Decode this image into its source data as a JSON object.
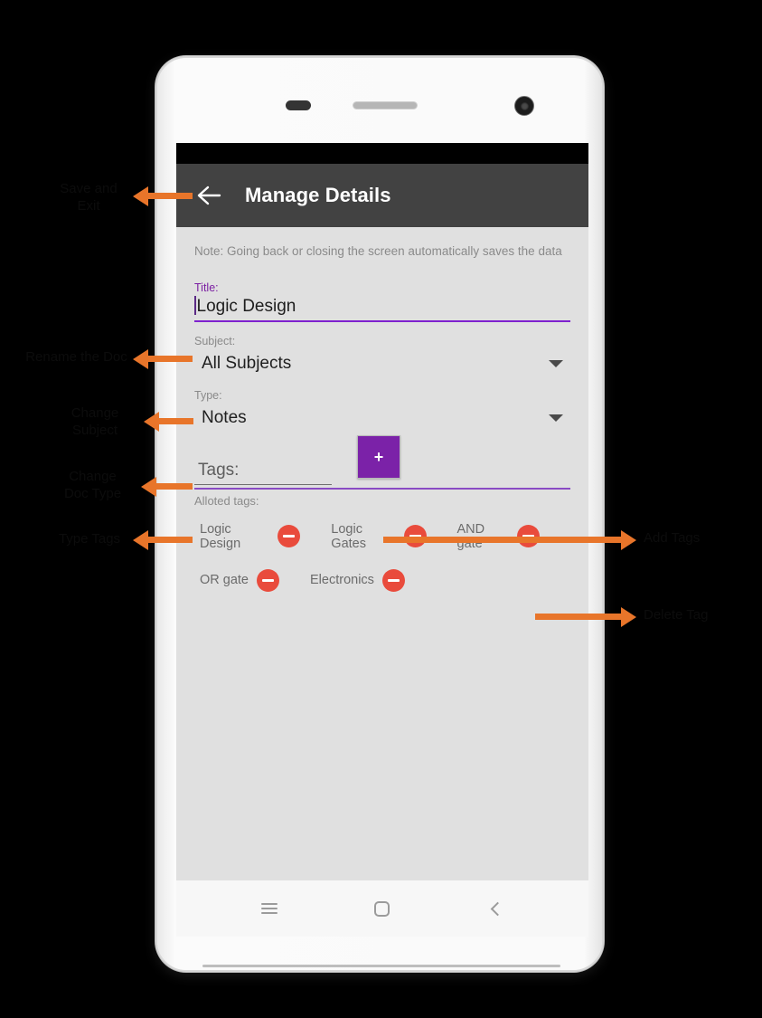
{
  "device": {
    "type": "android-phone-mockup",
    "frame_color": "#f7f7f7",
    "status_bar_color": "#000000"
  },
  "app_bar": {
    "back_icon": "arrow-left-icon",
    "title": "Manage Details",
    "background": "#424242",
    "title_color": "#ffffff"
  },
  "content": {
    "note": "Note: Going back or closing the screen automatically saves the data",
    "title_field": {
      "label": "Title:",
      "value": "Logic Design",
      "accent_color": "#7b1fa2",
      "underline_color": "#7e22ce"
    },
    "subject_field": {
      "label": "Subject:",
      "value": "All Subjects",
      "dropdown_icon": "chevron-down-icon"
    },
    "type_field": {
      "label": "Type:",
      "value": "Notes",
      "dropdown_icon": "chevron-down-icon"
    },
    "tags_field": {
      "placeholder": "Tags:",
      "value": "",
      "add_button_label": "+",
      "add_button_color": "#7b22a8",
      "underline_color": "#8a4bc4"
    },
    "alloted_tags": {
      "label": "Alloted tags:",
      "remove_icon": "minus-circle-icon",
      "remove_color": "#e94b3c",
      "rows": [
        [
          "Logic Design",
          "Logic Gates",
          "AND gate"
        ],
        [
          "OR gate",
          "Electronics"
        ]
      ]
    }
  },
  "nav_bar": {
    "recents_icon": "menu-icon",
    "home_icon": "square-icon",
    "back_icon": "chevron-left-icon"
  },
  "annotations": {
    "color": "#e8752a",
    "items": [
      {
        "id": "save-and-exit",
        "text": "Save and\nExit"
      },
      {
        "id": "rename-the-doc",
        "text": "Rename the Doc"
      },
      {
        "id": "change-subject",
        "text": "Change\nSubject"
      },
      {
        "id": "change-doc-type",
        "text": "Change\nDoc Type"
      },
      {
        "id": "type-tags",
        "text": "Type Tags"
      },
      {
        "id": "add-tags",
        "text": "Add Tags"
      },
      {
        "id": "delete-tag",
        "text": "Delete Tag"
      }
    ]
  }
}
